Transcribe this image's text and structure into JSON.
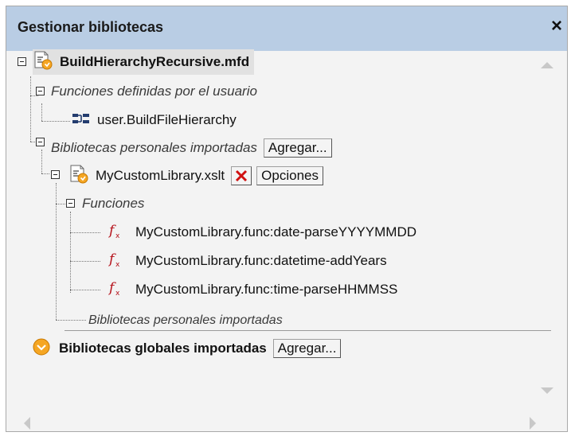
{
  "panel": {
    "title": "Gestionar bibliotecas",
    "close_glyph": "×"
  },
  "tree": {
    "root_label": "BuildHierarchyRecursive.mfd",
    "udf_group_label": "Funciones definidas por el usuario",
    "udf_item_label": "user.BuildFileHierarchy",
    "imported_group_label": "Bibliotecas personales importadas",
    "add_button_label": "Agregar...",
    "library_label": "MyCustomLibrary.xslt",
    "options_button_label": "Opciones",
    "functions_group_label": "Funciones",
    "functions": [
      "MyCustomLibrary.func:date-parseYYYYMMDD",
      "MyCustomLibrary.func:datetime-addYears",
      "MyCustomLibrary.func:time-parseHHMMSS"
    ],
    "imported_footer_label": "Bibliotecas personales importadas",
    "global_label": "Bibliotecas globales importadas",
    "global_add_button_label": "Agregar..."
  },
  "icons": {
    "mapping_file": "mfd-file-icon",
    "udf": "user-function-icon",
    "xslt_file": "xslt-file-icon",
    "function": "function-fx-icon",
    "delete": "delete-x-icon",
    "global": "global-library-icon"
  },
  "colors": {
    "title_bar": "#b9cde4",
    "panel_bg": "#f3f3f3",
    "delete_red": "#d01010",
    "function_red": "#b5121b",
    "global_orange": "#f5a623"
  }
}
